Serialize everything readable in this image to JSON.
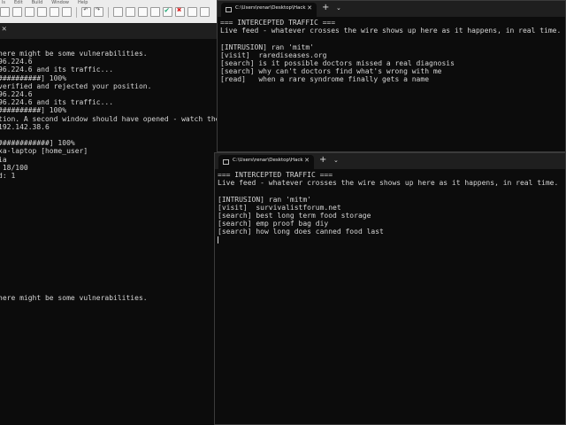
{
  "toolbar": {
    "menu": [
      "ls",
      "Edit",
      "Build",
      "Window",
      "Help"
    ]
  },
  "left_terminal": {
    "lines": [
      "here might be some vulnerabilities.",
      "96.224.6",
      "96.224.6 and its traffic...",
      "##########] 100%",
      "verified and rejected your position.",
      "96.224.6",
      "96.224.6 and its traffic...",
      "##########] 100%",
      "tion. A second window should have opened - watch their traffic",
      "192.142.38.6",
      "",
      "############] 100%",
      "xa-laptop [home_user]",
      "ia",
      " 18/100",
      "d: 1",
      "",
      "",
      "",
      "",
      "",
      "",
      "",
      "",
      "",
      "",
      "",
      "",
      "",
      "",
      "here might be some vulnerabilities."
    ]
  },
  "windows": [
    {
      "title": "C:\\Users\\renar\\Desktop\\Hack",
      "lines": [
        "=== INTERCEPTED TRAFFIC ===",
        "Live feed - whatever crosses the wire shows up here as it happens, in real time.",
        "",
        "[INTRUSION] ran 'mitm'",
        "[visit]  rarediseases.org",
        "[search] is it possible doctors missed a real diagnosis",
        "[search] why can't doctors find what's wrong with me",
        "[read]   when a rare syndrome finally gets a name"
      ]
    },
    {
      "title": "C:\\Users\\renar\\Desktop\\Hack",
      "lines": [
        "=== INTERCEPTED TRAFFIC ===",
        "Live feed - whatever crosses the wire shows up here as it happens, in real time.",
        "",
        "[INTRUSION] ran 'mitm'",
        "[visit]  survivalistforum.net",
        "[search] best long term food storage",
        "[search] emp proof bag diy",
        "[search] how long does canned food last"
      ]
    }
  ],
  "tab_controls": {
    "new_tab": "+",
    "dropdown": "⌄",
    "close": "✕"
  }
}
